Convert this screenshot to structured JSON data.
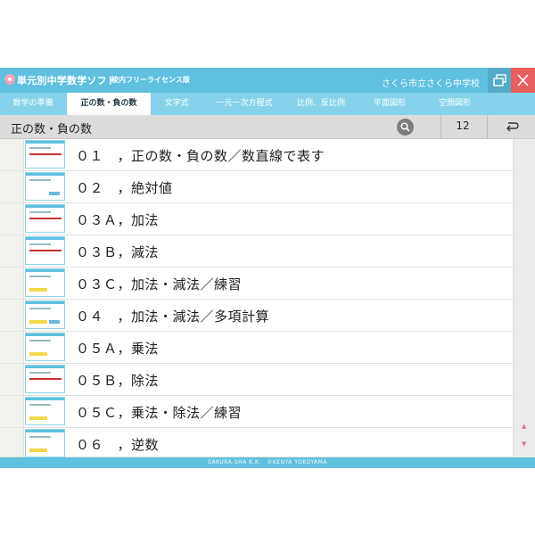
{
  "window": {
    "app_title": "単元別中学数学ソフト",
    "edition": "校内フリーライセンス版",
    "school": "さくら市立さくら中学校"
  },
  "tabs": [
    {
      "label": "数学の準備"
    },
    {
      "label": "正の数・負の数",
      "active": true
    },
    {
      "label": "文字式"
    },
    {
      "label": "一元一次方程式"
    },
    {
      "label": "比例、反比例"
    },
    {
      "label": "平面図形"
    },
    {
      "label": "空間図形"
    }
  ],
  "header": {
    "title": "正の数・負の数",
    "count": "12"
  },
  "lessons": [
    {
      "label": "０１　，正の数・負の数／数直線で表す"
    },
    {
      "label": "０２　，絶対値"
    },
    {
      "label": "０３Ａ，加法"
    },
    {
      "label": "０３Ｂ，減法"
    },
    {
      "label": "０３Ｃ，加法・減法／練習"
    },
    {
      "label": "０４　，加法・減法／多項計算"
    },
    {
      "label": "０５Ａ，乗法"
    },
    {
      "label": "０５Ｂ，除法"
    },
    {
      "label": "０５Ｃ，乗法・除法／練習"
    },
    {
      "label": "０６　，逆数"
    }
  ],
  "footer": {
    "credit": "SAKURA-SHA K.K.　©KENYA YOKOYAMA"
  },
  "colors": {
    "titlebar": "#5fc0df",
    "tabbar": "#86d2ea",
    "close": "#e85f5f"
  },
  "icons": [
    "app-logo-icon",
    "restore-icon",
    "close-icon",
    "search-icon",
    "back-icon"
  ]
}
